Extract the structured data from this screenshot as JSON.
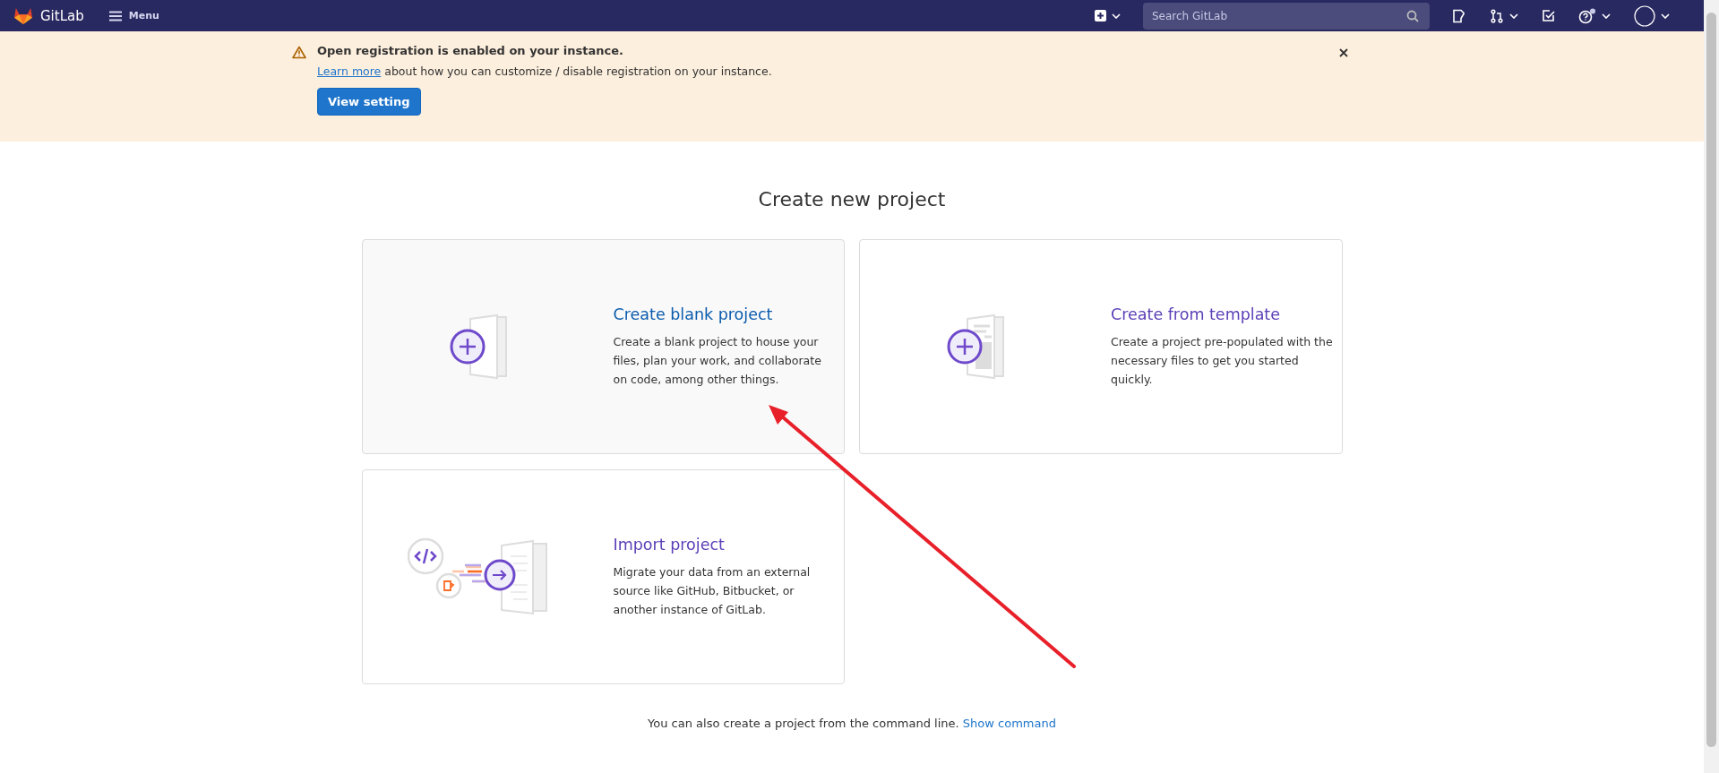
{
  "top_bar": {
    "brand": "GitLab",
    "menu": "Menu",
    "search": {
      "placeholder": "Search GitLab"
    },
    "help_has_notification": true
  },
  "alert": {
    "title": "Open registration is enabled on your instance.",
    "link": "Learn more",
    "message": "about how you can customize / disable registration on your instance.",
    "button": "View setting"
  },
  "page_title": "Create new project",
  "cards": [
    {
      "kind": "blank",
      "title": "Create blank project",
      "description": "Create a blank project to house your files, plan your work, and collaborate on code, among other things.",
      "hovered": true
    },
    {
      "kind": "template",
      "title": "Create from template",
      "description": "Create a project pre-populated with the necessary files to get you started quickly.",
      "hovered": false
    },
    {
      "kind": "import",
      "title": "Import project",
      "description": "Migrate your data from an external source like GitHub, Bitbucket, or another instance of GitLab.",
      "hovered": false
    }
  ],
  "footer": {
    "text": "You can also create a project from the command line.",
    "link": "Show command"
  }
}
